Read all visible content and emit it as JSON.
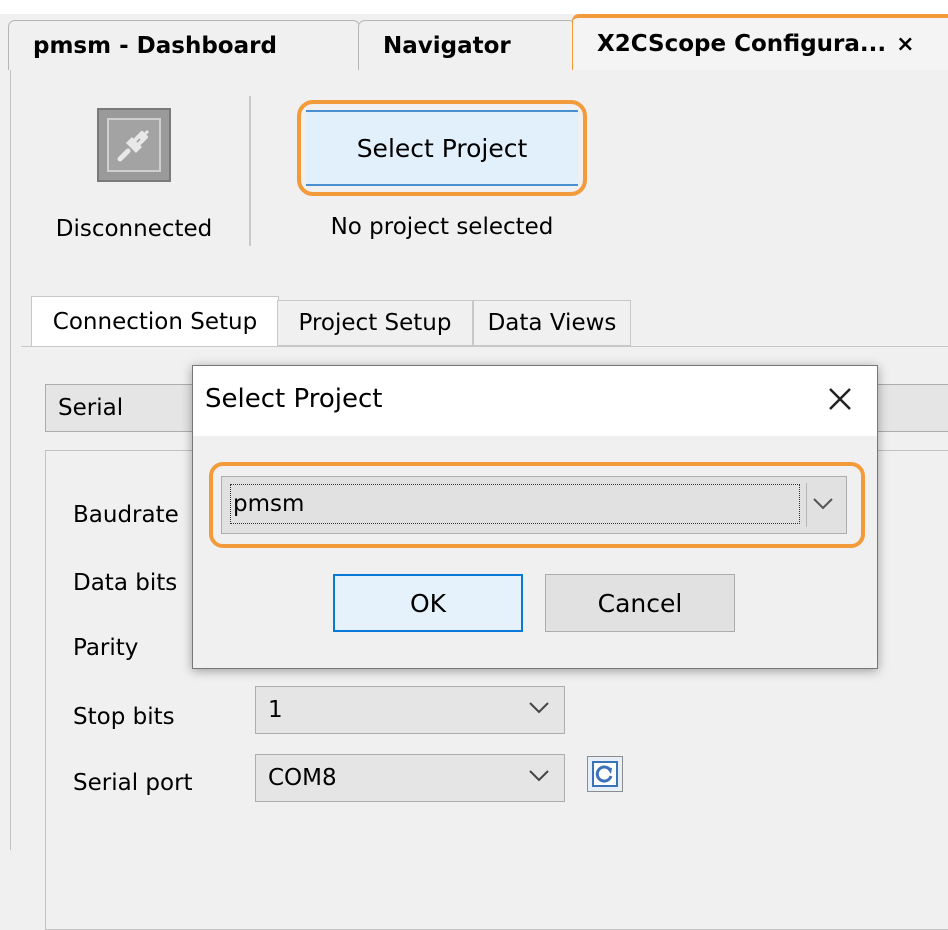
{
  "tabs": [
    {
      "label": "pmsm - Dashboard"
    },
    {
      "label": "Navigator"
    },
    {
      "label": "X2CScope Configura...",
      "close": "×"
    }
  ],
  "toolbar": {
    "connection_status": "Disconnected",
    "select_project_label": "Select Project",
    "project_status": "No project selected"
  },
  "subtabs": [
    {
      "label": "Connection Setup"
    },
    {
      "label": "Project Setup"
    },
    {
      "label": "Data Views"
    }
  ],
  "connection": {
    "interface": "Serial",
    "fields": [
      {
        "label": "Baudrate",
        "value": ""
      },
      {
        "label": "Data bits",
        "value": ""
      },
      {
        "label": "Parity",
        "value": ""
      },
      {
        "label": "Stop bits",
        "value": "1"
      },
      {
        "label": "Serial port",
        "value": "COM8"
      }
    ]
  },
  "dialog": {
    "title": "Select Project",
    "selected_project": "pmsm",
    "ok_label": "OK",
    "cancel_label": "Cancel"
  },
  "colors": {
    "highlight": "#f39a3b",
    "button_accent": "#0a78d7"
  }
}
